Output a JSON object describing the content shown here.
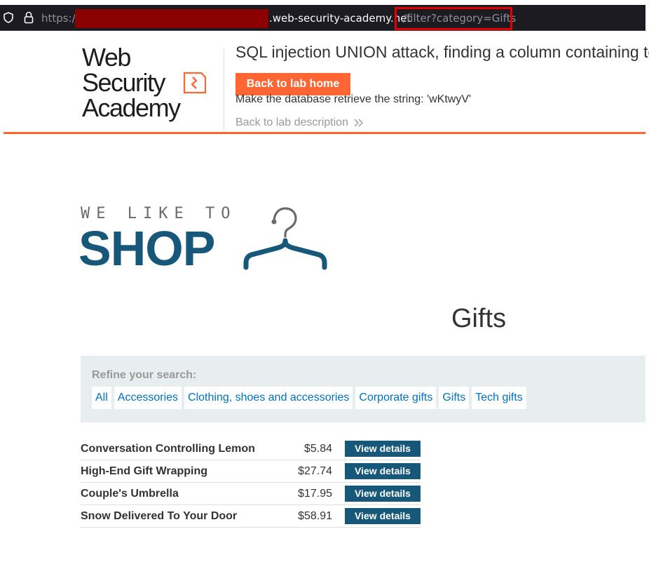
{
  "browser": {
    "url_scheme": "https://",
    "url_host": ".web-security-academy.net",
    "url_path": "/filter?category=Gifts",
    "highlight_color": "#e20000",
    "redaction_color": "#8b0000"
  },
  "academy": {
    "logo_line1": "Web Security",
    "logo_line2": "Academy",
    "lab_title": "SQL injection UNION attack, finding a column containing text",
    "back_home_label": "Back to lab home",
    "objective": "Make the database retrieve the string: 'wKtwyV'",
    "back_description_label": "Back to lab description",
    "accent_color": "#ff6633"
  },
  "shop": {
    "tagline": "WE LIKE TO",
    "wordmark": "SHOP",
    "brand_color": "#17587a"
  },
  "page_heading": "Gifts",
  "filter": {
    "label": "Refine your search:",
    "categories": [
      "All",
      "Accessories",
      "Clothing, shoes and accessories",
      "Corporate gifts",
      "Gifts",
      "Tech gifts"
    ]
  },
  "products": [
    {
      "name": "Conversation Controlling Lemon",
      "price": "$5.84",
      "button": "View details"
    },
    {
      "name": "High-End Gift Wrapping",
      "price": "$27.74",
      "button": "View details"
    },
    {
      "name": "Couple's Umbrella",
      "price": "$17.95",
      "button": "View details"
    },
    {
      "name": "Snow Delivered To Your Door",
      "price": "$58.91",
      "button": "View details"
    }
  ],
  "icons": [
    "shield-icon",
    "lock-icon",
    "chevron-double-right-icon",
    "hanger-icon",
    "logo-mark-icon"
  ]
}
